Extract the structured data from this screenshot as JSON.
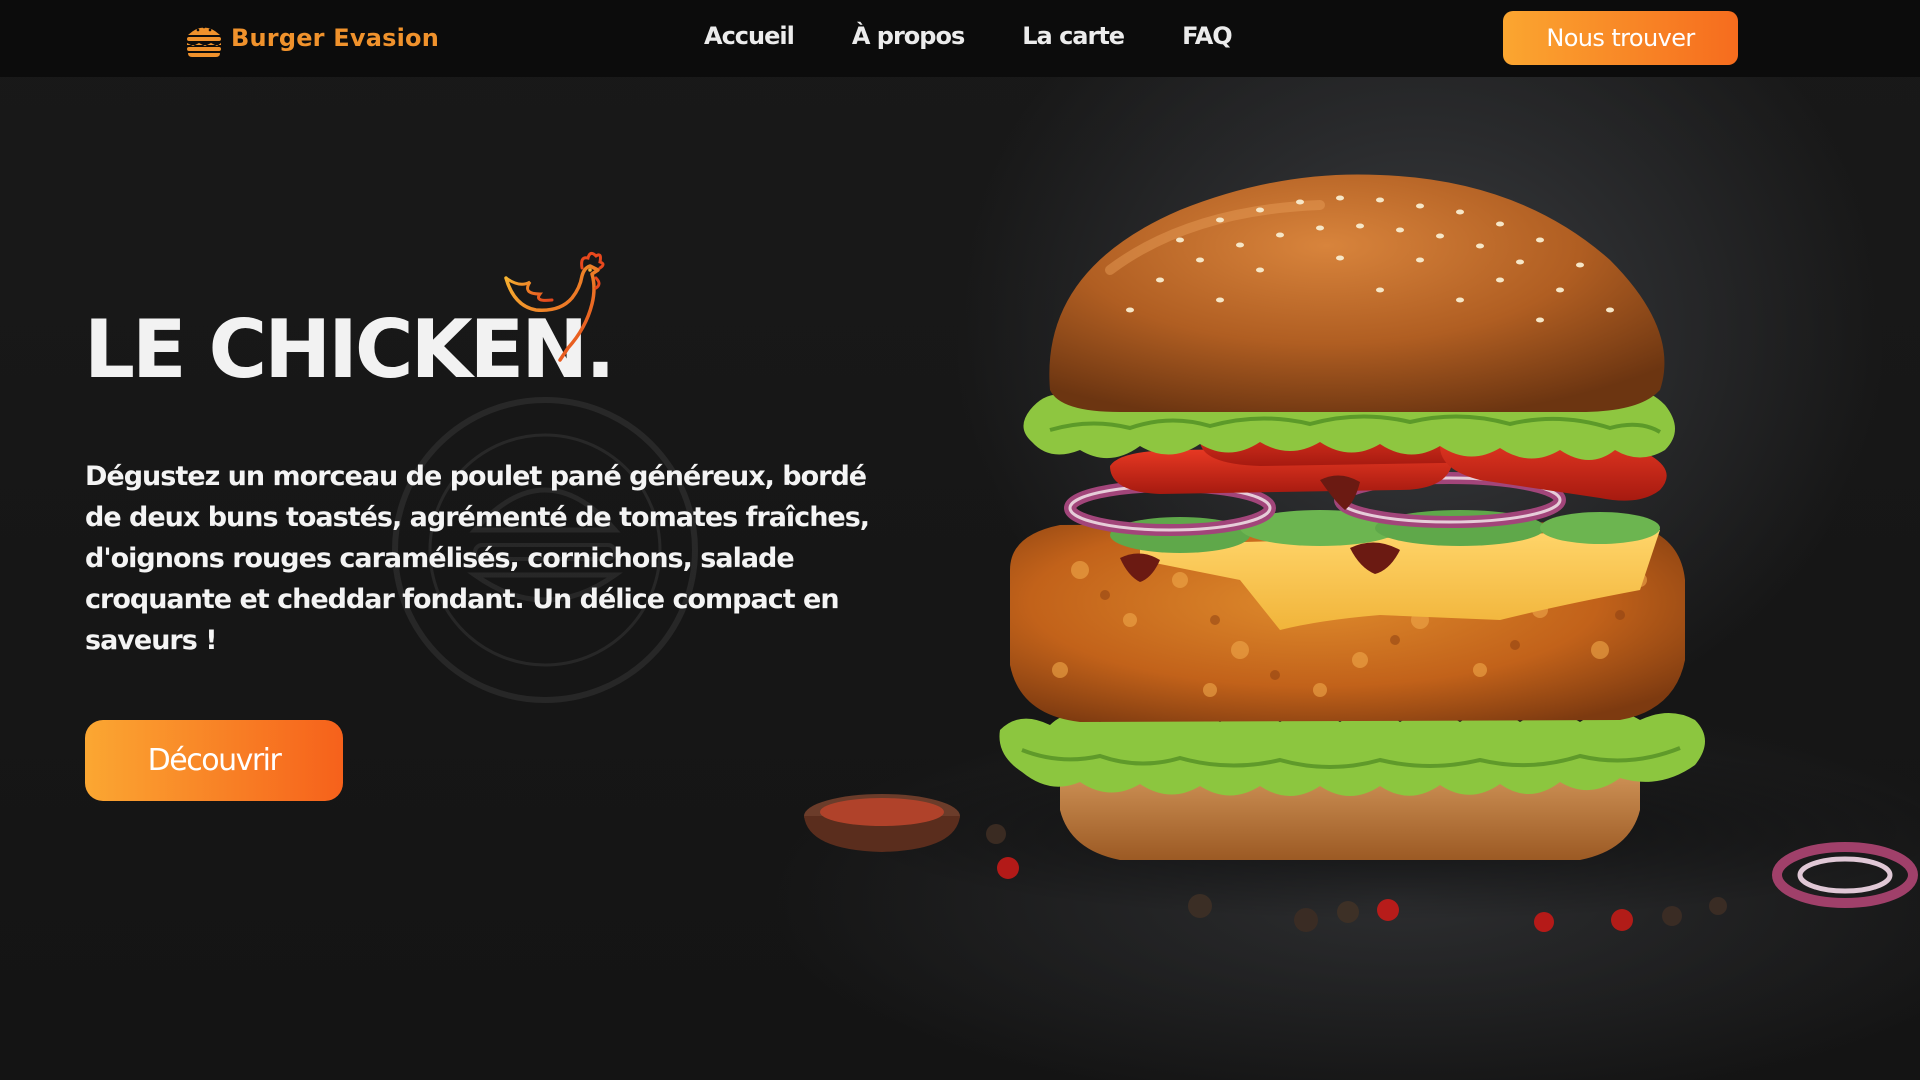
{
  "brand": {
    "name": "Burger Evasion",
    "color": "#f0922c"
  },
  "nav": {
    "links": [
      "Accueil",
      "À propos",
      "La carte",
      "FAQ"
    ],
    "cta_label": "Nous trouver"
  },
  "hero": {
    "title": "LE CHICKEN.",
    "description": "Dégustez un morceau de poulet pané généreux, bordé de deux buns toastés, agrémenté de tomates fraîches, d'oignons rouges caramélisés, cornichons, salade croquante et cheddar fondant. Un délice compact en saveurs !",
    "cta_label": "Découvrir"
  },
  "colors": {
    "accent_start": "#fba630",
    "accent_end": "#f66c1e",
    "background": "#141414",
    "navbar": "#0c0c0c"
  },
  "icons": {
    "logo": "burger-icon",
    "title_decoration": "chicken-icon"
  }
}
